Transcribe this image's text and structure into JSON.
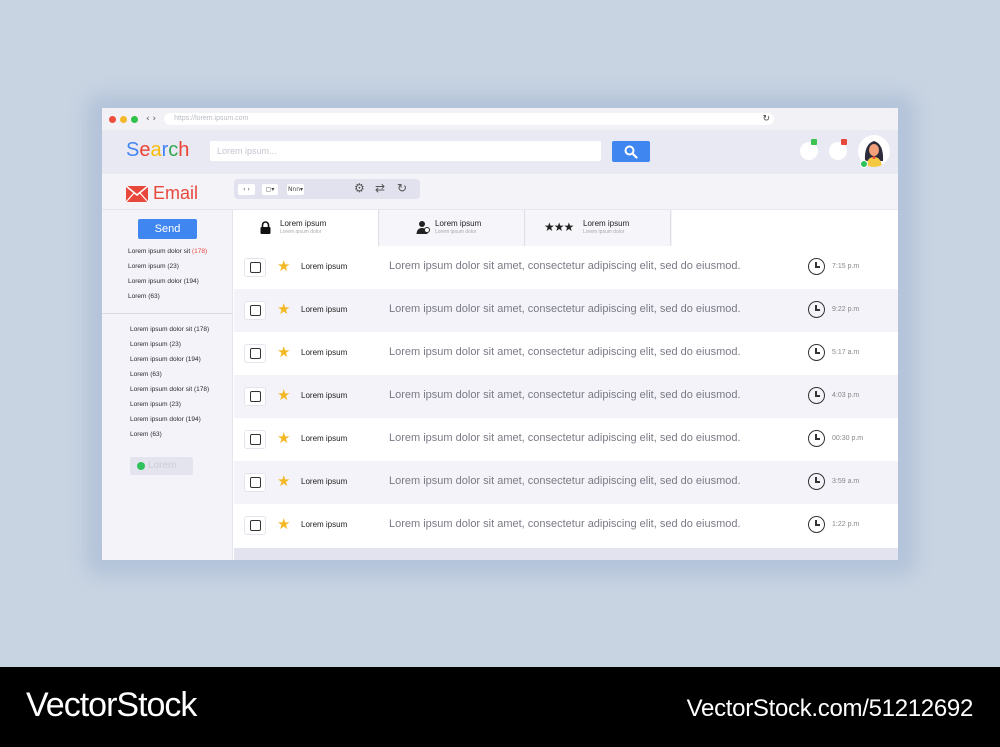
{
  "browser": {
    "url": "https://lorem.ipsum.com",
    "nav_arrows": "‹ ›",
    "reload_icon": "↻"
  },
  "header": {
    "logo": "Search",
    "logo_colors": [
      "#4285f4",
      "#ea4335",
      "#fbbc05",
      "#4285f4",
      "#34a853",
      "#ea4335"
    ],
    "search_placeholder": "Lorem ipsum...",
    "accent": "#3f86f0"
  },
  "mail_header": {
    "title": "Email",
    "toolbar": {
      "code_btn": "‹ ›",
      "select_btn": "▢▾",
      "menu_btn": "Nnn▾"
    }
  },
  "sidebar": {
    "send_label": "Send",
    "folders_top": [
      {
        "label": "Lorem ipsum dolor sit",
        "count": "(178)"
      },
      {
        "label": "Lorem ipsum (23)"
      },
      {
        "label": "Lorem ipsum dolor (194)"
      },
      {
        "label": "Lorem (63)"
      }
    ],
    "folders_bottom": [
      "Lorem ipsum dolor sit (178)",
      "Lorem ipsum (23)",
      "Lorem ipsum dolor (194)",
      "Lorem (63)",
      "Lorem ipsum dolor sit (178)",
      "Lorem ipsum (23)",
      "Lorem ipsum dolor (194)",
      "Lorem (63)"
    ],
    "status_label": "Lorem"
  },
  "tabs": [
    {
      "icon": "lock-icon",
      "label": "Lorem ipsum",
      "sublabel": "Lorem ipsum dolor"
    },
    {
      "icon": "person-icon",
      "label": "Lorem ipsum",
      "sublabel": "Lorem ipsum dolor"
    },
    {
      "icon": "three-stars-icon",
      "label": "Lorem ipsum",
      "sublabel": "Lorem ipsum dolor"
    }
  ],
  "emails": [
    {
      "sender": "Lorem ipsum",
      "message": "Lorem ipsum dolor sit amet, consectetur adipiscing elit, sed do eiusmod.",
      "time": "7:15 p.m"
    },
    {
      "sender": "Lorem ipsum",
      "message": "Lorem ipsum dolor sit amet, consectetur adipiscing elit, sed do eiusmod.",
      "time": "9:22 p.m"
    },
    {
      "sender": "Lorem ipsum",
      "message": "Lorem ipsum dolor sit amet, consectetur adipiscing elit, sed do eiusmod.",
      "time": "5:17 a.m"
    },
    {
      "sender": "Lorem ipsum",
      "message": "Lorem ipsum dolor sit amet, consectetur adipiscing elit, sed do eiusmod.",
      "time": "4:03 p.m"
    },
    {
      "sender": "Lorem ipsum",
      "message": "Lorem ipsum dolor sit amet, consectetur adipiscing elit, sed do eiusmod.",
      "time": "00:30 p.m"
    },
    {
      "sender": "Lorem ipsum",
      "message": "Lorem ipsum dolor sit amet, consectetur adipiscing elit, sed do eiusmod.",
      "time": "3:59 a.m"
    },
    {
      "sender": "Lorem ipsum",
      "message": "Lorem ipsum dolor sit amet, consectetur adipiscing elit, sed do eiusmod.",
      "time": "1:22 p.m"
    }
  ],
  "watermark": {
    "brand": "VectorStock",
    "credit": "VectorStock.com/51212692"
  }
}
